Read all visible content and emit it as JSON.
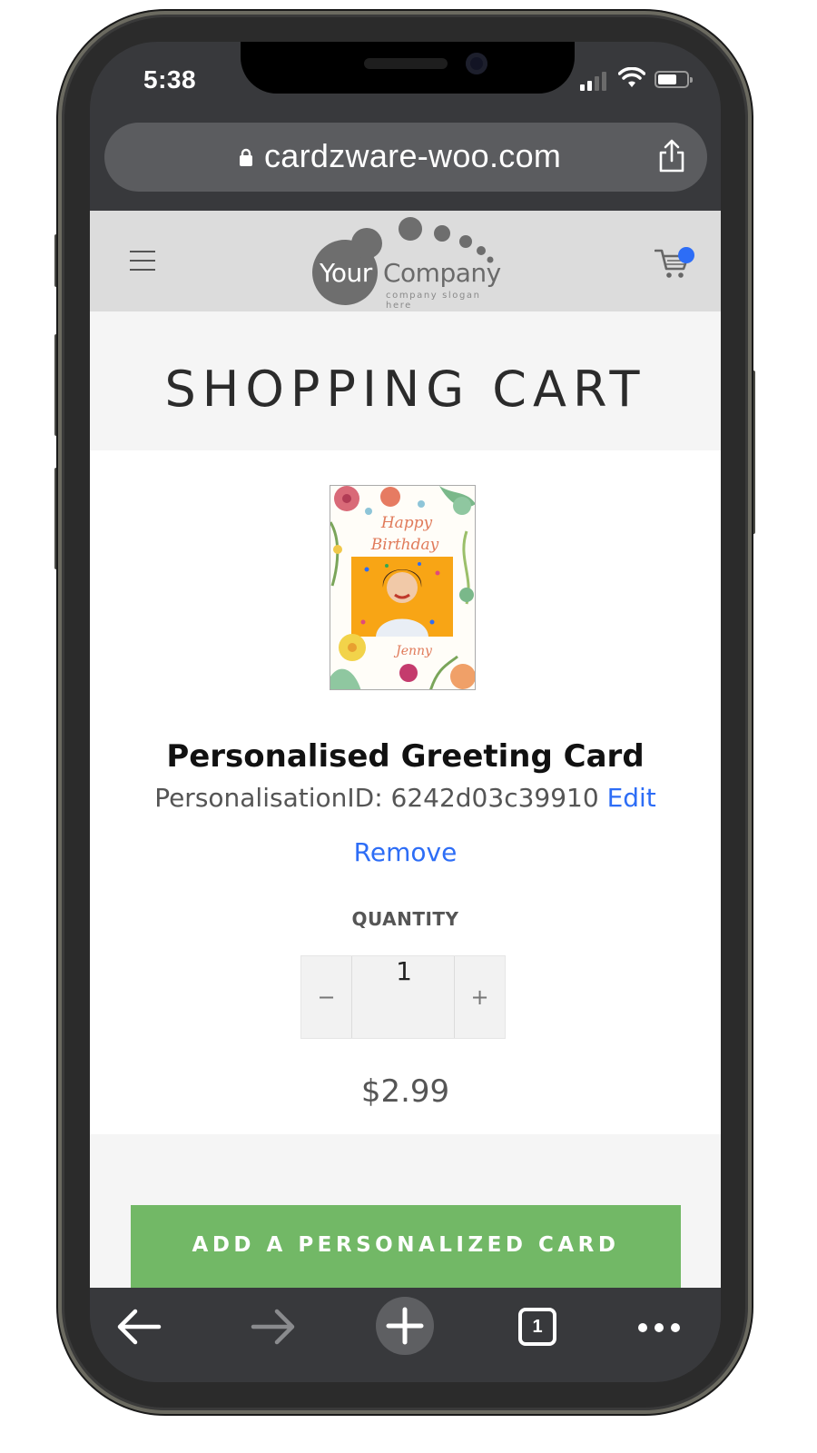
{
  "status_bar": {
    "time": "5:38"
  },
  "browser": {
    "url": "cardzware-woo.com",
    "icons": {
      "lock": "lock-icon",
      "share": "share-icon",
      "back": "arrow-left-icon",
      "forward": "arrow-right-icon",
      "new_tab": "plus-icon",
      "tabs": "tabs-icon",
      "more": "more-dots-icon"
    },
    "tab_count": "1"
  },
  "site": {
    "logo": {
      "word1": "Your",
      "word2": "Company",
      "slogan": "company slogan here"
    },
    "icons": {
      "menu": "hamburger-icon",
      "cart": "cart-icon"
    },
    "colors": {
      "header_bg": "#dcdcdc",
      "link": "#2d6df6",
      "cta": "#72b866",
      "cart_badge": "#2d6df6"
    }
  },
  "page": {
    "title": "SHOPPING CART"
  },
  "cart_item": {
    "thumbnail": {
      "line1": "Happy",
      "line2": "Birthday",
      "name": "Jenny"
    },
    "name": "Personalised Greeting Card",
    "personalisation_label": "PersonalisationID: 6242d03c39910",
    "edit_label": "Edit",
    "remove_label": "Remove",
    "quantity_label": "QUANTITY",
    "quantity_minus": "−",
    "quantity_value": "1",
    "quantity_plus": "+",
    "price": "$2.99"
  },
  "cta": {
    "label": "ADD A PERSONALIZED CARD"
  }
}
